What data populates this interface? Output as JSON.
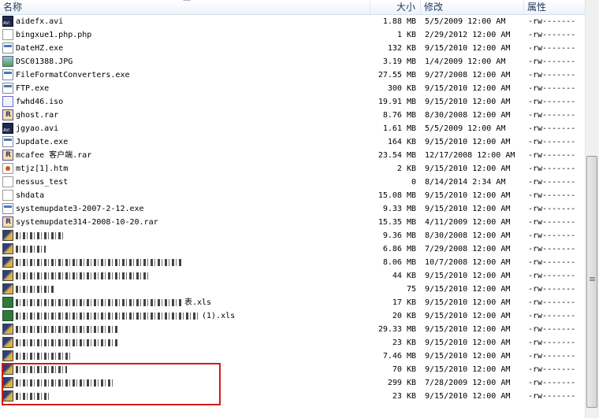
{
  "columns": {
    "name": "名称",
    "size": "大小",
    "modified": "修改",
    "perms": "属性"
  },
  "files": [
    {
      "name": "aidefx.avi",
      "size": "1.88 MB",
      "modified": "5/5/2009 12:00 AM",
      "perms": "-rw-------",
      "icon": "avi-file-icon"
    },
    {
      "name": "bingxue1.php.php",
      "size": "1 KB",
      "modified": "2/29/2012 12:00 AM",
      "perms": "-rw-------",
      "icon": "document-file-icon"
    },
    {
      "name": "DateHZ.exe",
      "size": "132 KB",
      "modified": "9/15/2010 12:00 AM",
      "perms": "-rw-------",
      "icon": "exe-file-icon"
    },
    {
      "name": "DSC01388.JPG",
      "size": "3.19 MB",
      "modified": "1/4/2009 12:00 AM",
      "perms": "-rw-------",
      "icon": "image-file-icon"
    },
    {
      "name": "FileFormatConverters.exe",
      "size": "27.55 MB",
      "modified": "9/27/2008 12:00 AM",
      "perms": "-rw-------",
      "icon": "exe-file-icon"
    },
    {
      "name": "FTP.exe",
      "size": "300 KB",
      "modified": "9/15/2010 12:00 AM",
      "perms": "-rw-------",
      "icon": "exe-file-icon"
    },
    {
      "name": "fwhd46.iso",
      "size": "19.91 MB",
      "modified": "9/15/2010 12:00 AM",
      "perms": "-rw-------",
      "icon": "iso-file-icon"
    },
    {
      "name": "ghost.rar",
      "size": "8.76 MB",
      "modified": "8/30/2008 12:00 AM",
      "perms": "-rw-------",
      "icon": "rar-file-icon"
    },
    {
      "name": "jgyao.avi",
      "size": "1.61 MB",
      "modified": "5/5/2009 12:00 AM",
      "perms": "-rw-------",
      "icon": "avi-file-icon"
    },
    {
      "name": "Jupdate.exe",
      "size": "164 KB",
      "modified": "9/15/2010 12:00 AM",
      "perms": "-rw-------",
      "icon": "exe-file-icon"
    },
    {
      "name": "mcafee 客户端.rar",
      "size": "23.54 MB",
      "modified": "12/17/2008 12:00 AM",
      "perms": "-rw-------",
      "icon": "rar-file-icon"
    },
    {
      "name": "mtjz[1].htm",
      "size": "2 KB",
      "modified": "9/15/2010 12:00 AM",
      "perms": "-rw-------",
      "icon": "html-file-icon"
    },
    {
      "name": "nessus_test",
      "size": "0",
      "modified": "8/14/2014 2:34 AM",
      "perms": "-rw-------",
      "icon": "document-file-icon"
    },
    {
      "name": "shdata",
      "size": "15.08 MB",
      "modified": "9/15/2010 12:00 AM",
      "perms": "-rw-------",
      "icon": "document-file-icon"
    },
    {
      "name": "systemupdate3-2007-2-12.exe",
      "size": "9.33 MB",
      "modified": "9/15/2010 12:00 AM",
      "perms": "-rw-------",
      "icon": "exe-file-icon"
    },
    {
      "name": "systemupdate314-2008-10-20.rar",
      "size": "15.35 MB",
      "modified": "4/11/2009 12:00 AM",
      "perms": "-rw-------",
      "icon": "rar-file-icon"
    },
    {
      "name": "",
      "size": "9.36 MB",
      "modified": "8/30/2008 12:00 AM",
      "perms": "-rw-------",
      "icon": "obscured-file-icon"
    },
    {
      "name": "",
      "size": "6.86 MB",
      "modified": "7/29/2008 12:00 AM",
      "perms": "-rw-------",
      "icon": "obscured-file-icon"
    },
    {
      "name": "",
      "size": "8.06 MB",
      "modified": "10/7/2008 12:00 AM",
      "perms": "-rw-------",
      "icon": "obscured-file-icon"
    },
    {
      "name": "",
      "size": "44 KB",
      "modified": "9/15/2010 12:00 AM",
      "perms": "-rw-------",
      "icon": "obscured-file-icon"
    },
    {
      "name": "",
      "size": "75",
      "modified": "9/15/2010 12:00 AM",
      "perms": "-rw-------",
      "icon": "obscured-file-icon"
    },
    {
      "name": "表.xls",
      "size": "17 KB",
      "modified": "9/15/2010 12:00 AM",
      "perms": "-rw-------",
      "icon": "excel-file-icon"
    },
    {
      "name": "(1).xls",
      "size": "20 KB",
      "modified": "9/15/2010 12:00 AM",
      "perms": "-rw-------",
      "icon": "excel-file-icon"
    },
    {
      "name": "",
      "size": "29.33 MB",
      "modified": "9/15/2010 12:00 AM",
      "perms": "-rw-------",
      "icon": "obscured-file-icon"
    },
    {
      "name": "",
      "size": "23 KB",
      "modified": "9/15/2010 12:00 AM",
      "perms": "-rw-------",
      "icon": "obscured-file-icon"
    },
    {
      "name": "",
      "size": "7.46 MB",
      "modified": "9/15/2010 12:00 AM",
      "perms": "-rw-------",
      "icon": "obscured-file-icon"
    },
    {
      "name": "",
      "size": "70 KB",
      "modified": "9/15/2010 12:00 AM",
      "perms": "-rw-------",
      "icon": "obscured-file-icon"
    },
    {
      "name": "",
      "size": "299 KB",
      "modified": "7/28/2009 12:00 AM",
      "perms": "-rw-------",
      "icon": "obscured-file-icon"
    },
    {
      "name": "",
      "size": "23 KB",
      "modified": "9/15/2010 12:00 AM",
      "perms": "-rw-------",
      "icon": "obscured-file-icon"
    }
  ],
  "colors": {
    "header_text": "#1e395b",
    "annotation": "#d21a1a"
  }
}
